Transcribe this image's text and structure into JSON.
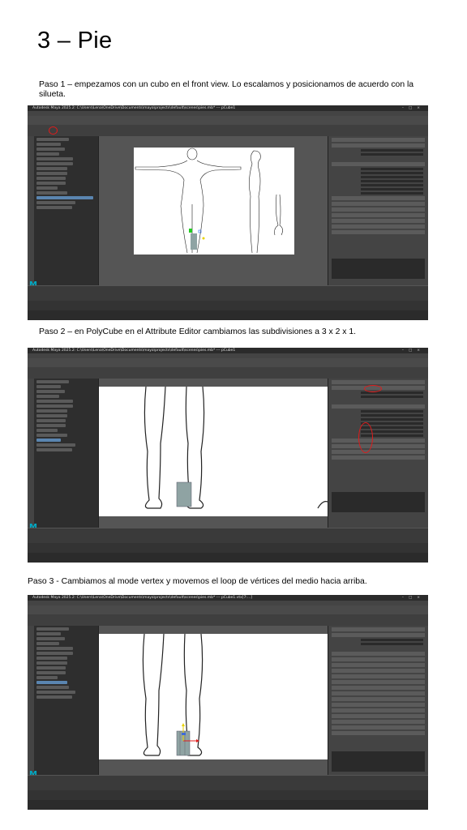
{
  "title": "3 – Pie",
  "steps": [
    {
      "text": "Paso 1 – empezamos con un cubo en el front view. Lo escalamos y posicionamos de acuerdo con la silueta."
    },
    {
      "text": "Paso 2 – en PolyCube en el Attribute Editor cambiamos las subdivisiones a 3 x 2 x 1."
    },
    {
      "text": "Paso 3  - Cambiamos al mode vertex y movemos el loop de vértices del medio hacia arriba."
    }
  ],
  "screenshots": [
    {
      "app_title": "Autodesk Maya 2025.2: C:\\Users\\Lena\\OneDrive\\Documents\\maya\\projects\\default\\scenes\\pies.mb* --- pCube1",
      "logo": "M"
    },
    {
      "app_title": "Autodesk Maya 2025.2: C:\\Users\\Lena\\OneDrive\\Documents\\maya\\projects\\default\\scenes\\pies.mb* --- pCube1",
      "logo": "M"
    },
    {
      "app_title": "Autodesk Maya 2025.2: C:\\Users\\Lena\\OneDrive\\Documents\\maya\\projects\\default\\scenes\\pies.mb* --- pCube1.vtx[7:...]",
      "logo": "M"
    }
  ],
  "colors": {
    "accent": "#e01b1b",
    "maya_bg": "#3b3b3b",
    "selection": "#5a85b0",
    "cube": "#8fa3a3"
  }
}
